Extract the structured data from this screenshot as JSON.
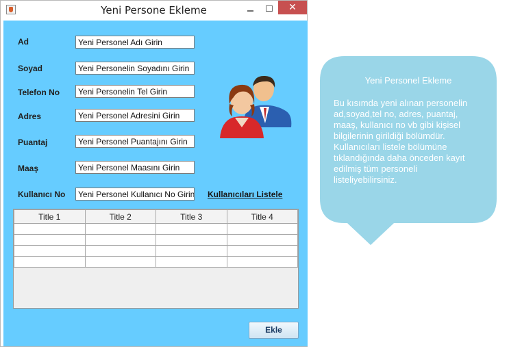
{
  "window": {
    "title": "Yeni Persone Ekleme",
    "close_glyph": "✕"
  },
  "form": {
    "fields": [
      {
        "label": "Ad",
        "placeholder": "Yeni Personel Adı Girin"
      },
      {
        "label": "Soyad",
        "placeholder": "Yeni Personelin Soyadını Girin"
      },
      {
        "label": "Telefon No",
        "placeholder": "Yeni Personelin Tel Girin"
      },
      {
        "label": "Adres",
        "placeholder": "Yeni Personel Adresini Girin"
      },
      {
        "label": "Puantaj",
        "placeholder": "Yeni Personel Puantajını Girin"
      },
      {
        "label": "Maaş",
        "placeholder": "Yeni Personel Maasını Girin"
      },
      {
        "label": "Kullanıcı No",
        "placeholder": "Yeni Personel Kullanıcı No Girin"
      }
    ],
    "list_users_link": "Kullanıcıları Listele",
    "add_button": "Ekle"
  },
  "table": {
    "columns": [
      "Title 1",
      "Title 2",
      "Title 3",
      "Title 4"
    ],
    "empty_rows": 4
  },
  "callout": {
    "title": "Yeni Personel Ekleme",
    "body": "Bu kısımda yeni alınan personelin ad,soyad,tel no, adres, puantaj, maaş, kullanıcı no vb gibi kişisel bilgilerinin girildiği bölümdür. Kullanıcıları listele bölümüne tıklandığında daha önceden kayıt edilmiş tüm personeli listeliyebilirsiniz.",
    "color": "#9ad6e8"
  },
  "colors": {
    "panel": "#66ccff",
    "close": "#c75050"
  },
  "icons": {
    "app": "java-cup-icon",
    "users": "users-icon"
  }
}
